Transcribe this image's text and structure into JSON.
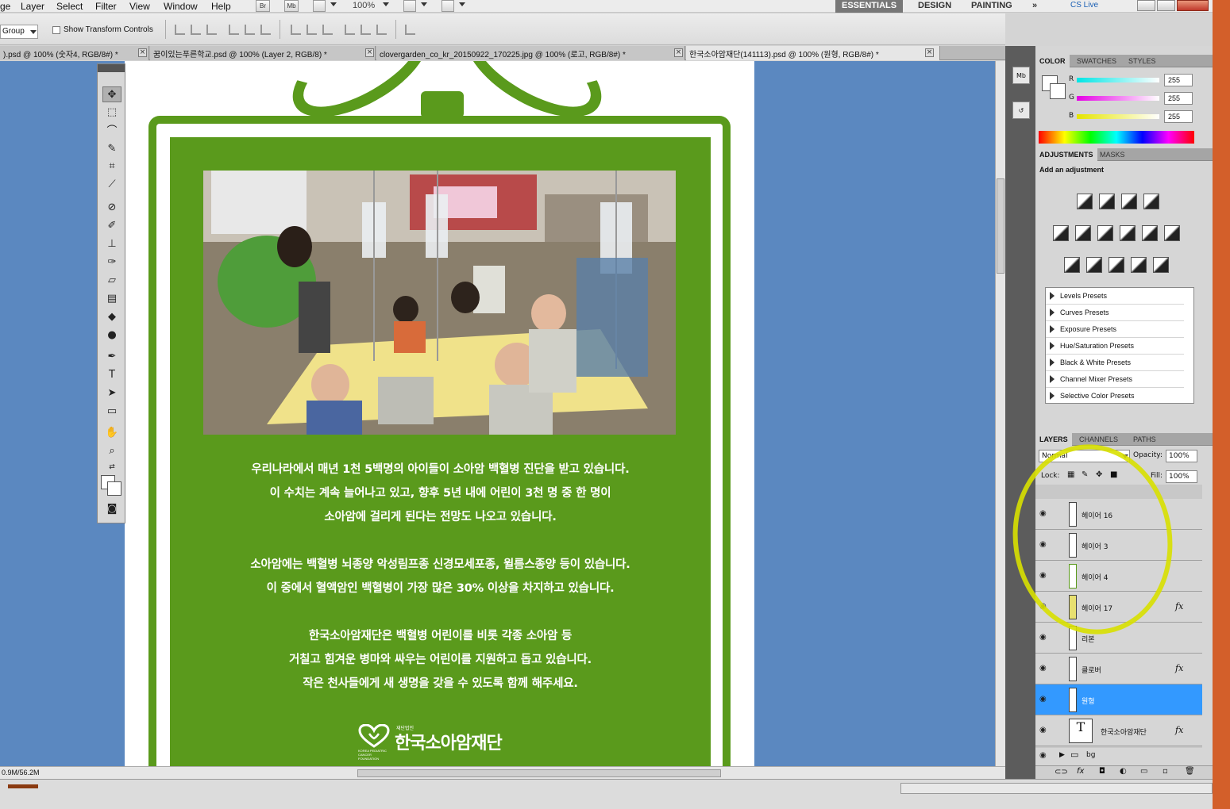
{
  "menubar": {
    "items": [
      "ge",
      "Layer",
      "Select",
      "Filter",
      "View",
      "Window",
      "Help"
    ],
    "bridge_btn": "Br",
    "minibridge_btn": "Mb",
    "zoom": "100%",
    "workspaces": [
      "ESSENTIALS",
      "DESIGN",
      "PAINTING"
    ],
    "more": "»",
    "cs_live": "CS Live"
  },
  "options": {
    "auto_select": "Group",
    "transform_label": "Show Transform Controls"
  },
  "tabs": [
    {
      "label": ").psd @ 100% (숫자4, RGB/8#) *"
    },
    {
      "label": "꿈이있는푸른학교.psd @ 100% (Layer 2, RGB/8) *"
    },
    {
      "label": "clovergarden_co_kr_20150922_170225.jpg  @  100%  (로고, RGB/8#) *"
    },
    {
      "label": "한국소아암재단(141113).psd @ 100% (원형, RGB/8#) *"
    }
  ],
  "poster": {
    "para1": [
      "우리나라에서 매년 1천 5백명의 아이들이 소아암 백혈병 진단을 받고 있습니다.",
      "이 수치는 계속 늘어나고 있고, 향후 5년 내에 어린이 3천 명 중 한 명이",
      "소아암에 걸리게 된다는 전망도 나오고 있습니다."
    ],
    "para2": [
      "소아암에는 백혈병 뇌종양 악성림프종 신경모세포종, 윌름스종양 등이 있습니다.",
      "이 중에서 혈액암인 백혈병이 가장 많은 30% 이상을 차지하고 있습니다."
    ],
    "para3": [
      "한국소아암재단은 백혈병 어린이를 비롯 각종 소아암 등",
      "거칠고 힘겨운 병마와 싸우는 어린이를 지원하고 돕고 있습니다.",
      "작은 천사들에게 새 생명을 갖을 수 있도록 함께 해주세요."
    ],
    "logo_sub": "재단법인",
    "logo_main": "한국소아암재단",
    "logo_en": "KOREA PEDIATRIC CANCER FOUNDATION",
    "green": "#5a9a1c"
  },
  "status": {
    "doc_size": "0.9M/56.2M"
  },
  "color_panel": {
    "tabs": [
      "COLOR",
      "SWATCHES",
      "STYLES"
    ],
    "channels": [
      {
        "name": "R",
        "value": "255",
        "color": "#00e5e5"
      },
      {
        "name": "G",
        "value": "255",
        "color": "#e500e5"
      },
      {
        "name": "B",
        "value": "255",
        "color": "#e5e500"
      }
    ]
  },
  "adjustments": {
    "tabs": [
      "ADJUSTMENTS",
      "MASKS"
    ],
    "title": "Add an adjustment",
    "presets": [
      "Levels Presets",
      "Curves Presets",
      "Exposure Presets",
      "Hue/Saturation Presets",
      "Black & White Presets",
      "Channel Mixer Presets",
      "Selective Color Presets"
    ]
  },
  "layers": {
    "tabs": [
      "LAYERS",
      "CHANNELS",
      "PATHS"
    ],
    "blend_mode": "Normal",
    "opacity_label": "Opacity:",
    "opacity": "100%",
    "lock_label": "Lock:",
    "fill_label": "Fill:",
    "fill": "100%",
    "rows": [
      {
        "name": "헤이어 16",
        "fx": ""
      },
      {
        "name": "헤이어 3",
        "fx": ""
      },
      {
        "name": "헤이어 4",
        "fx": ""
      },
      {
        "name": "헤이어 17",
        "fx": "fx"
      },
      {
        "name": "리본",
        "fx": ""
      },
      {
        "name": "클로버",
        "fx": "fx"
      },
      {
        "name": "원형",
        "fx": ""
      },
      {
        "name": "한국소아암재단",
        "fx": "fx"
      }
    ],
    "group": "bg"
  }
}
